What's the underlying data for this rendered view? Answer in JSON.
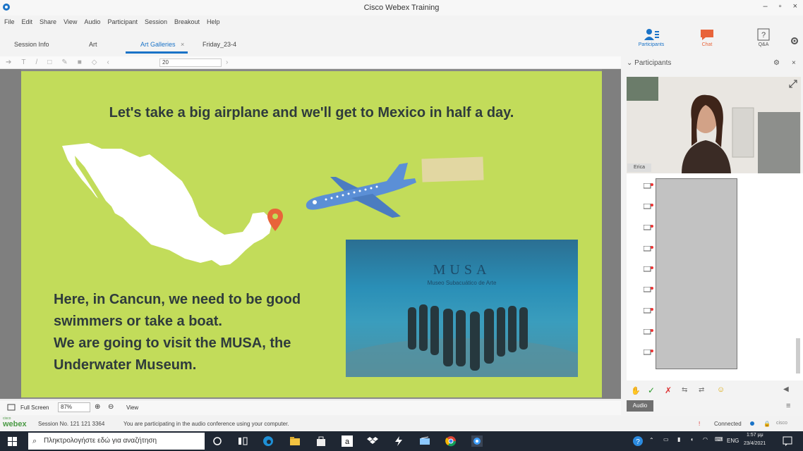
{
  "window": {
    "title": "Cisco Webex Training",
    "controls": [
      "–",
      "▫",
      "×"
    ]
  },
  "menu": [
    "File",
    "Edit",
    "Share",
    "View",
    "Audio",
    "Participant",
    "Session",
    "Breakout",
    "Help"
  ],
  "tabs": [
    {
      "label": "Session Info"
    },
    {
      "label": "Art"
    },
    {
      "label": "Art Galleries",
      "active": true
    },
    {
      "label": "Friday_23-4"
    }
  ],
  "panel_buttons": {
    "participants": "Participants",
    "chat": "Chat",
    "qa": "Q&A"
  },
  "toolbar": {
    "zoom_value": "20"
  },
  "slide": {
    "heading": "Let's take a big airplane and we'll get to Mexico in half a day.",
    "body_lines": [
      "Here, in Cancun, we need to be good",
      "swimmers or take a boat.",
      "We are going to visit the MUSA, the",
      "Underwater Museum."
    ],
    "musa_logo": "MUSA",
    "musa_sub": "Museo Subacuático de Arte",
    "colors": {
      "background": "#c2dc5a",
      "text": "#2f3b3c",
      "plane": "#5b8fd6",
      "pin": "#e8643a"
    }
  },
  "right_panel": {
    "title": "Participants",
    "video_label": "Erica",
    "audio_button": "Audio"
  },
  "bottom": {
    "full_screen": "Full Screen",
    "zoom": "87%",
    "view": "View"
  },
  "status": {
    "brand_small": "cisco",
    "brand": "webex",
    "session": "Session No. 121 121 3364",
    "message": "You are participating in the audio conference using your computer.",
    "connected": "Connected",
    "brand_right": "cisco"
  },
  "taskbar": {
    "search_placeholder": "Πληκτρολογήστε εδώ για αναζήτηση",
    "language": "ENG",
    "time": "1:57 μμ",
    "date": "23/4/2021"
  }
}
